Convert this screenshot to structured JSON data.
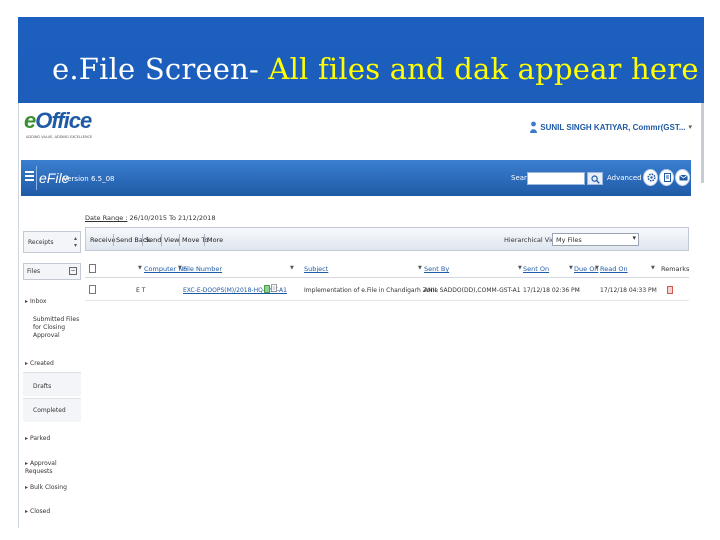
{
  "slide": {
    "title_prefix": "e.File Screen-",
    "title_rest": " All files and dak appear here",
    "band_color": "#1d5ebb",
    "title_accent_color": "#ffff00"
  },
  "header": {
    "logo_text_e": "e",
    "logo_text_rest": "Office",
    "logo_tagline": "ADDING VALUE, ADDING EXCELLENCE",
    "user_name": "SUNIL SINGH KATIYAR, Commr(GST..."
  },
  "navbar": {
    "app_name": "eFile",
    "version": "Version 6.5_08",
    "search_label": "Search",
    "search_value": "",
    "advanced_label": "Advanced",
    "accent": "#1f5aa6",
    "icons": [
      "settings-icon",
      "document-icon",
      "mail-icon"
    ]
  },
  "sidebar": {
    "select_value": "Receipts",
    "files_label": "Files",
    "items": [
      {
        "label": "Inbox",
        "level": 1
      },
      {
        "label": "Submitted Files for Closing Approval",
        "level": 2
      },
      {
        "label": "Created",
        "level": 1
      },
      {
        "label": "Drafts",
        "level": 2
      },
      {
        "label": "Completed",
        "level": 2
      },
      {
        "label": "Parked",
        "level": 1
      },
      {
        "label": "Approval Requests",
        "level": 1
      },
      {
        "label": "Bulk Closing",
        "level": 1
      },
      {
        "label": "Closed",
        "level": 1
      }
    ]
  },
  "content": {
    "date_range_label": "Date Range :",
    "date_range_value": "26/10/2015 To 21/12/2018",
    "toolbar": {
      "buttons": [
        "Receive",
        "Send Back",
        "Send",
        "View",
        "Move To",
        "More"
      ],
      "view_label": "Hierarchical View",
      "view_value": "My Files"
    },
    "table": {
      "columns": [
        "Computer No",
        "File Number",
        "Subject",
        "Sent By",
        "Sent On",
        "Due On",
        "Read On",
        "Remarks"
      ],
      "rows": [
        {
          "computer_no": "E T",
          "file_number": "EXC-E-DOOPS(M)/2018-HQ-GST-A1",
          "subject": "Implementation of e.File in Chandigarh Zone",
          "sent_by": "ANIL SADDO(DD),COMM-GST-A1",
          "sent_on": "17/12/18 02:36 PM",
          "due_on": "-",
          "read_on": "17/12/18 04:33 PM"
        }
      ]
    }
  }
}
